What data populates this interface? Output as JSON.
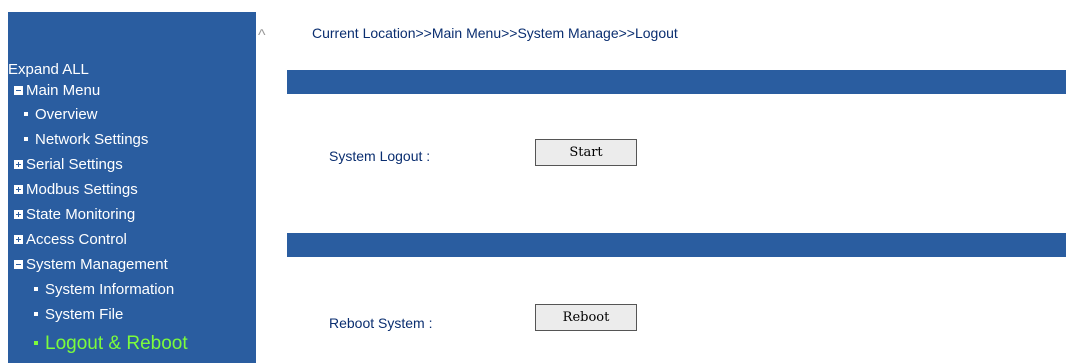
{
  "sidebar": {
    "expand_all": "Expand ALL",
    "main_menu": "Main Menu",
    "items": {
      "overview": "Overview",
      "network_settings": "Network Settings",
      "serial_settings": "Serial Settings",
      "modbus_settings": "Modbus Settings",
      "state_monitoring": "State Monitoring",
      "access_control": "Access Control",
      "system_management": "System Management",
      "system_information": "System Information",
      "system_file": "System File",
      "logout_reboot": "Logout & Reboot"
    },
    "active_color": "#7cfc3c",
    "background_color": "#2a5da0"
  },
  "scroll_arrow": "^",
  "breadcrumb": "Current Location>>Main Menu>>System Manage>>Logout",
  "logout_section": {
    "label": "System Logout :",
    "button": "Start"
  },
  "reboot_section": {
    "label": "Reboot System :",
    "button": "Reboot"
  }
}
